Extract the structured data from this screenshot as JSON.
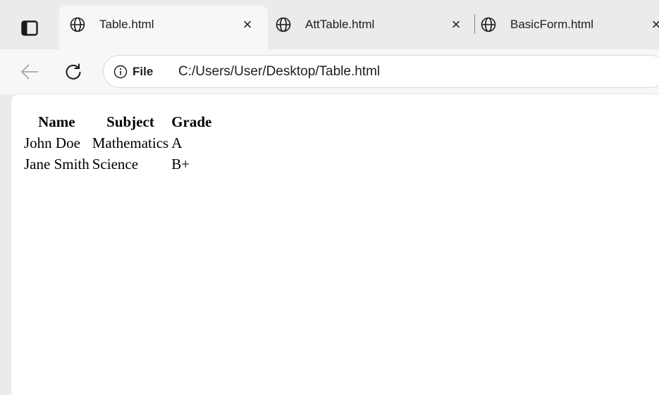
{
  "browser": {
    "tabs": [
      {
        "title": "Table.html",
        "close_label": "×",
        "active": true
      },
      {
        "title": "AttTable.html",
        "close_label": "×",
        "active": false
      },
      {
        "title": "BasicForm.html",
        "close_label": "×",
        "active": false
      }
    ],
    "address_bar": {
      "site_info_label": "File",
      "url": "C:/Users/User/Desktop/Table.html"
    },
    "colors": {
      "tabstrip": "#ebebeb",
      "active_tab": "#f7f7f7",
      "page_bg": "#ffffff"
    }
  },
  "page": {
    "table": {
      "headers": [
        "Name",
        "Subject",
        "Grade"
      ],
      "rows": [
        [
          "John Doe",
          "Mathematics",
          "A"
        ],
        [
          "Jane Smith",
          "Science",
          "B+"
        ]
      ]
    }
  }
}
